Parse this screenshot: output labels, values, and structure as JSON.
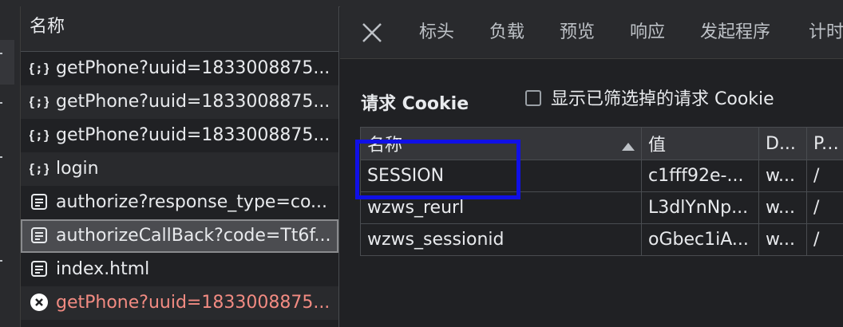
{
  "colors": {
    "panel": "#202124",
    "header": "#292a2d",
    "selected": "#4b4c50",
    "error_text": "#f28b82",
    "highlight": "#1010e6"
  },
  "request_list": {
    "header": "名称",
    "rows": [
      {
        "icon": "fetch-icon",
        "label": "getPhone?uuid=1833008875..."
      },
      {
        "icon": "fetch-icon",
        "label": "getPhone?uuid=1833008875..."
      },
      {
        "icon": "fetch-icon",
        "label": "getPhone?uuid=1833008875..."
      },
      {
        "icon": "fetch-icon",
        "label": "login"
      },
      {
        "icon": "document-icon",
        "label": "authorize?response_type=co..."
      },
      {
        "icon": "document-icon",
        "label": "authorizeCallBack?code=Tt6f...",
        "selected": true
      },
      {
        "icon": "document-icon",
        "label": "index.html"
      },
      {
        "icon": "error-icon",
        "label": "getPhone?uuid=1833008875...",
        "error": true
      }
    ]
  },
  "detail": {
    "tabs": [
      "标头",
      "负载",
      "预览",
      "响应",
      "发起程序",
      "计时"
    ],
    "close_icon": "close-icon",
    "cookie_title": "请求 Cookie",
    "show_filtered_label": "显示已筛选掉的请求 Cookie",
    "show_filtered_checked": false,
    "table": {
      "headers": [
        "名称",
        "值",
        "D...",
        "P..."
      ],
      "sort_column": "名称",
      "sort_icon": "sort-ascending-icon",
      "rows": [
        [
          "SESSION",
          "c1fff92e-...",
          "w...",
          "/"
        ],
        [
          "wzws_reurl",
          "L3dlYnNp...",
          "w...",
          "/"
        ],
        [
          "wzws_sessionid",
          "oGbec1iA...",
          "w...",
          "/"
        ]
      ]
    }
  }
}
